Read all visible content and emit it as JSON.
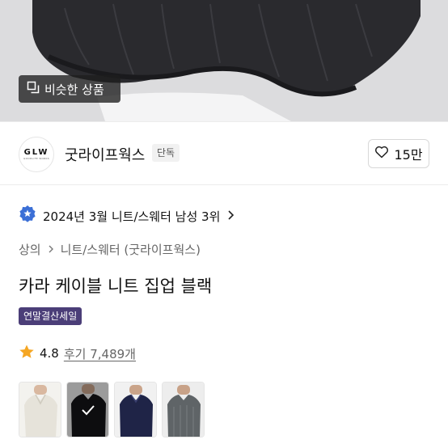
{
  "hero": {
    "similar_products_label": "비슷한 상품"
  },
  "brand": {
    "logo_text": "GLW",
    "logo_subtext": "GOODLIFE WORKS",
    "name": "굿라이프웍스",
    "badge": "단독"
  },
  "like": {
    "count": "15만"
  },
  "ranking": {
    "text": "2024년 3월 니트/스웨터 남성 3위"
  },
  "breadcrumb": {
    "level1": "상의",
    "level2": "니트/스웨터 (굿라이프웍스)"
  },
  "product": {
    "title": "카라 케이블 니트 집업 블랙",
    "tag": "연말결산세일"
  },
  "rating": {
    "score": "4.8",
    "reviews": "후기 7,489개"
  },
  "colors": {
    "options": [
      {
        "name": "ivory",
        "hex": "#e9e7e1",
        "selected": false
      },
      {
        "name": "black",
        "hex": "#151517",
        "selected": true
      },
      {
        "name": "navy",
        "hex": "#1f2447",
        "selected": false
      },
      {
        "name": "gray",
        "hex": "#5f6467",
        "selected": false
      }
    ]
  },
  "theme": {
    "tag_color": "#4b3e78",
    "badge_blue": "#3b6fd6",
    "star_color": "#f5a623"
  }
}
